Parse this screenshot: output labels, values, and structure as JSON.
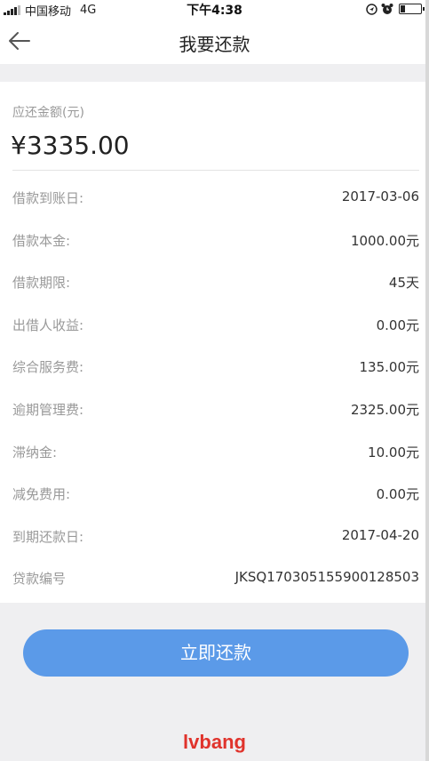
{
  "status_bar": {
    "carrier": "中国移动",
    "network": "4G",
    "time": "下午4:38"
  },
  "header": {
    "title": "我要还款"
  },
  "amount": {
    "label": "应还金额(元)",
    "value": "¥3335.00"
  },
  "details": [
    {
      "label": "借款到账日:",
      "value": "2017-03-06"
    },
    {
      "label": "借款本金:",
      "value": "1000.00元"
    },
    {
      "label": "借款期限:",
      "value": "45天"
    },
    {
      "label": "出借人收益:",
      "value": "0.00元"
    },
    {
      "label": "综合服务费:",
      "value": "135.00元"
    },
    {
      "label": "逾期管理费:",
      "value": "2325.00元"
    },
    {
      "label": "滞纳金:",
      "value": "10.00元"
    },
    {
      "label": "减免费用:",
      "value": "0.00元"
    },
    {
      "label": "到期还款日:",
      "value": "2017-04-20"
    },
    {
      "label": "贷款编号",
      "value": "JKSQ170305155900128503"
    }
  ],
  "actions": {
    "repay_label": "立即还款"
  },
  "watermark": {
    "text": "lvbang"
  },
  "colors": {
    "button": "#5b9ae8",
    "watermark": "#e0332c",
    "background": "#efeff1"
  },
  "icons": {
    "back": "arrow-left-icon",
    "signal": "signal-icon",
    "location": "location-icon",
    "alarm": "alarm-icon",
    "battery": "battery-icon"
  }
}
